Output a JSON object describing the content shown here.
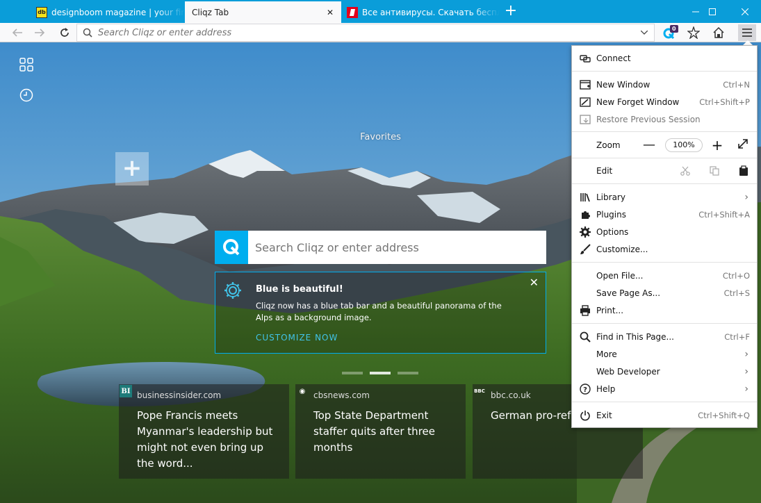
{
  "tabs": [
    {
      "title": "designboom magazine | your first",
      "favicon": "designboom-icon",
      "favicon_text": "db"
    },
    {
      "title": "Cliqz Tab",
      "close": "✕"
    },
    {
      "title": "Все антивирусы. Скачать беспла",
      "favicon": "antivirus-icon"
    }
  ],
  "new_tab": "+",
  "nav": {
    "search_placeholder": "Search Cliqz or enter address",
    "extension_badge": "0"
  },
  "page": {
    "favorites_label": "Favorites",
    "search_placeholder": "Search Cliqz or enter address",
    "promo": {
      "title": "Blue is beautiful!",
      "text": "Cliqz now has a blue tab bar and a beautiful panorama of the Alps as a background image.",
      "cta": "CUSTOMIZE NOW",
      "accent": "#00aeef"
    },
    "news": [
      {
        "domain": "businessinsider.com",
        "icon_text": "BI",
        "headline": "Pope Francis meets Myanmar's leadership but might not even bring up the word..."
      },
      {
        "domain": "cbsnews.com",
        "icon_text": "◉",
        "headline": "Top State Department staffer quits after three months"
      },
      {
        "domain": "bbc.co.uk",
        "icon_text": "BBC",
        "headline": "German pro-refu stabbed"
      }
    ]
  },
  "menu": {
    "connect": "Connect",
    "new_window": {
      "label": "New Window",
      "shortcut": "Ctrl+N"
    },
    "new_forget_window": {
      "label": "New Forget Window",
      "shortcut": "Ctrl+Shift+P"
    },
    "restore_session": {
      "label": "Restore Previous Session"
    },
    "zoom": {
      "label": "Zoom",
      "value": "100%",
      "minus": "—",
      "plus": "+"
    },
    "edit": {
      "label": "Edit"
    },
    "library": {
      "label": "Library"
    },
    "plugins": {
      "label": "Plugins",
      "shortcut": "Ctrl+Shift+A"
    },
    "options": {
      "label": "Options"
    },
    "customize": {
      "label": "Customize..."
    },
    "open_file": {
      "label": "Open File...",
      "shortcut": "Ctrl+O"
    },
    "save_page": {
      "label": "Save Page As...",
      "shortcut": "Ctrl+S"
    },
    "print": {
      "label": "Print..."
    },
    "find": {
      "label": "Find in This Page...",
      "shortcut": "Ctrl+F"
    },
    "more": {
      "label": "More"
    },
    "web_developer": {
      "label": "Web Developer"
    },
    "help": {
      "label": "Help"
    },
    "exit": {
      "label": "Exit",
      "shortcut": "Ctrl+Shift+Q"
    }
  },
  "colors": {
    "tab_bar": "#0a9dd9",
    "cliqz_blue": "#00aeef"
  }
}
